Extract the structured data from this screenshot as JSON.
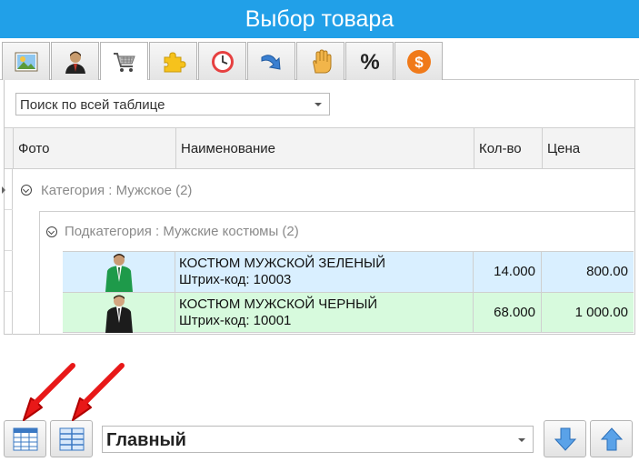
{
  "window": {
    "title": "Выбор товара"
  },
  "tabs": [
    {
      "icon": "picture-icon"
    },
    {
      "icon": "user-icon"
    },
    {
      "icon": "cart-icon",
      "active": true
    },
    {
      "icon": "puzzle-icon"
    },
    {
      "icon": "clock-icon"
    },
    {
      "icon": "redo-arrow-icon"
    },
    {
      "icon": "hand-icon"
    },
    {
      "icon": "percent-icon"
    },
    {
      "icon": "dollar-icon"
    }
  ],
  "search": {
    "placeholder": "Поиск по всей таблице"
  },
  "grid": {
    "columns": [
      "Фото",
      "Наименование",
      "Кол-во",
      "Цена"
    ],
    "group_category": "Категория : Мужское (2)",
    "group_subcategory": "Подкатегория : Мужские костюмы (2)",
    "rows": [
      {
        "name": "КОСТЮМ МУЖСКОЙ ЗЕЛЕНЫЙ",
        "barcode": "Штрих-код: 10003",
        "qty": "14.000",
        "price": "800.00",
        "bg": "#d9efff"
      },
      {
        "name": "КОСТЮМ МУЖСКОЙ ЧЕРНЫЙ",
        "barcode": "Штрих-код: 10001",
        "qty": "68.000",
        "price": "1 000.00",
        "bg": "#d7fadd"
      }
    ]
  },
  "bottom": {
    "view_selector": "Главный",
    "buttons": [
      "table-view-icon",
      "card-view-icon",
      "arrow-down-icon",
      "arrow-up-icon"
    ]
  },
  "colors": {
    "titlebar": "#21a0e8",
    "annotation_arrow": "#e81818"
  }
}
